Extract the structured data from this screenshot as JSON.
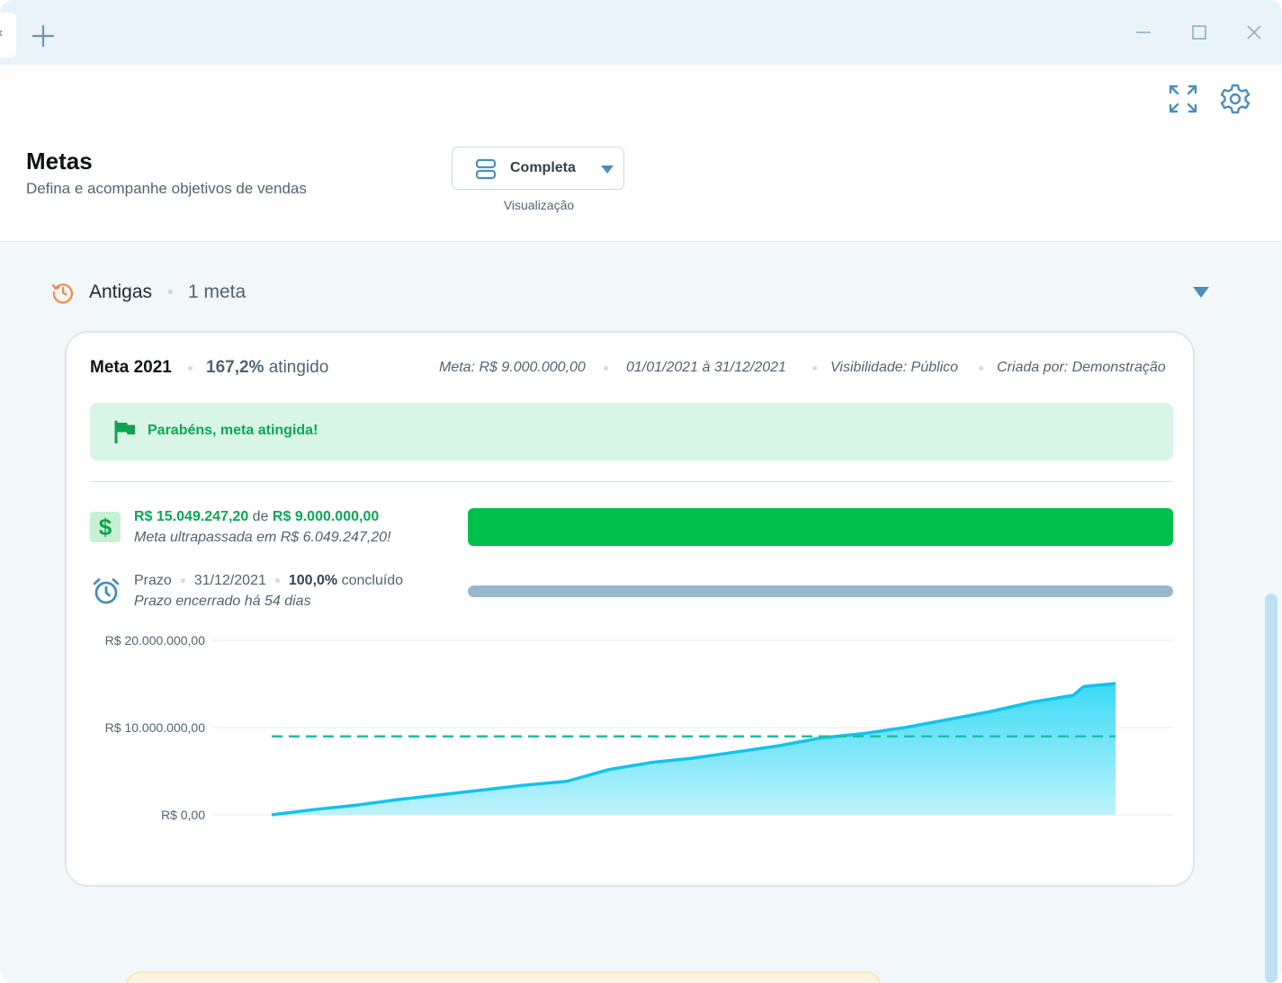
{
  "window": {
    "controls": {
      "minimize": "minimize-icon",
      "maximize": "maximize-icon",
      "close": "close-icon"
    },
    "tab_stub": "‹"
  },
  "header": {
    "title": "Metas",
    "subtitle": "Defina e acompanhe objetivos de vendas",
    "view_select": {
      "value": "Completa",
      "label": "Visualização"
    },
    "icons": [
      "expand-icon",
      "gear-icon"
    ]
  },
  "section": {
    "title": "Antigas",
    "count": "1 meta"
  },
  "goal": {
    "name": "Meta 2021",
    "percent": "167,2%",
    "percent_suffix": " atingido",
    "meta_value": "Meta:  R$ 9.000.000,00",
    "period": "01/01/2021 à 31/12/2021",
    "visibility": "Visibilidade:  Público",
    "created_by": "Criada por:  Demonstração",
    "banner": "Parabéns, meta atingida!",
    "achieved": "R$ 15.049.247,20",
    "of_word": "de",
    "target": "R$ 9.000.000,00",
    "surplus_note": "Meta ultrapassada em R$ 6.049.247,20!",
    "money_progress": 1.0,
    "deadline_label": "Prazo",
    "deadline_date": "31/12/2021",
    "time_percent": "100,0%",
    "time_suffix": " concluído",
    "deadline_note": "Prazo encerrado há 54 dias",
    "time_progress": 1.0,
    "colors": {
      "achieved": "#00c04b",
      "time": "#98b7cf",
      "area": "#22d3f3",
      "target_line": "#19c0a0"
    }
  },
  "chart_data": {
    "type": "area",
    "y_ticks": [
      {
        "value": 20000000,
        "label": "R$ 20.000.000,00"
      },
      {
        "value": 10000000,
        "label": "R$ 10.000.000,00"
      },
      {
        "value": 0,
        "label": "R$ 0,00"
      }
    ],
    "ylim": [
      0,
      20000000
    ],
    "target": 9000000,
    "x": [
      0,
      0.05,
      0.1,
      0.15,
      0.2,
      0.25,
      0.3,
      0.35,
      0.4,
      0.45,
      0.5,
      0.55,
      0.6,
      0.65,
      0.7,
      0.75,
      0.8,
      0.85,
      0.9,
      0.95,
      0.962,
      1.0
    ],
    "values": [
      0,
      600000,
      1100000,
      1750000,
      2300000,
      2850000,
      3400000,
      3850000,
      5200000,
      6000000,
      6500000,
      7200000,
      7900000,
      8800000,
      9300000,
      10000000,
      10900000,
      11800000,
      12900000,
      13700000,
      14700000,
      15049247
    ]
  }
}
